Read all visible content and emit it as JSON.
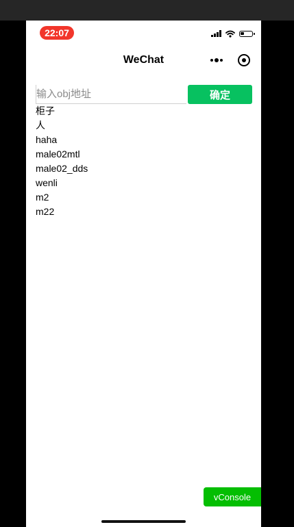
{
  "status_bar": {
    "time": "22:07",
    "battery_level": 0.35,
    "time_pill_color": "#f2362b"
  },
  "nav": {
    "title": "WeChat"
  },
  "form": {
    "placeholder": "输入obj地址",
    "value": "",
    "confirm_label": "确定",
    "confirm_color": "#07c160"
  },
  "items": [
    "柜子",
    "人",
    "haha",
    "male02mtl",
    "male02_dds",
    "wenli",
    "m2",
    "m22"
  ],
  "vconsole": {
    "label": "vConsole",
    "color": "#04be02"
  }
}
